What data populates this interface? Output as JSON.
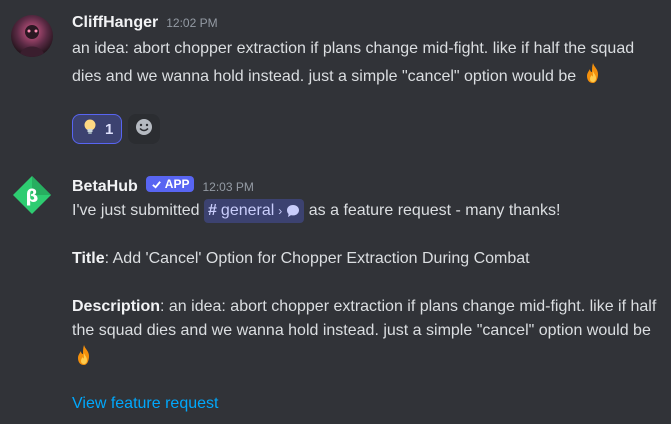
{
  "message1": {
    "username": "CliffHanger",
    "timestamp": "12:02 PM",
    "text": "an idea: abort chopper extraction if plans change mid-fight. like if half the squad dies and we wanna hold instead. just a simple \"cancel\" option would be",
    "emoji_icon": "fire-emoji",
    "reaction": {
      "icon": "lightbulb-emoji",
      "count": "1"
    },
    "add_reaction_icon": "smiley-add-reaction-icon"
  },
  "message2": {
    "username": "BetaHub",
    "badge_label": "APP",
    "timestamp": "12:03 PM",
    "intro_before": "I've just submitted",
    "channel_hash": "#",
    "channel_name": "general",
    "intro_after": "as a feature request - many thanks!",
    "title_label": "Title",
    "title_value": ": Add 'Cancel' Option for Chopper Extraction During Combat",
    "description_label": "Description",
    "description_value": ": an idea: abort chopper extraction if plans change mid-fight. like if half the squad dies and we wanna hold instead. just a simple \"cancel\" option would be",
    "link_text": "View feature request"
  },
  "colors": {
    "background": "#313338",
    "accent": "#5865f2",
    "link": "#00a8fc"
  }
}
